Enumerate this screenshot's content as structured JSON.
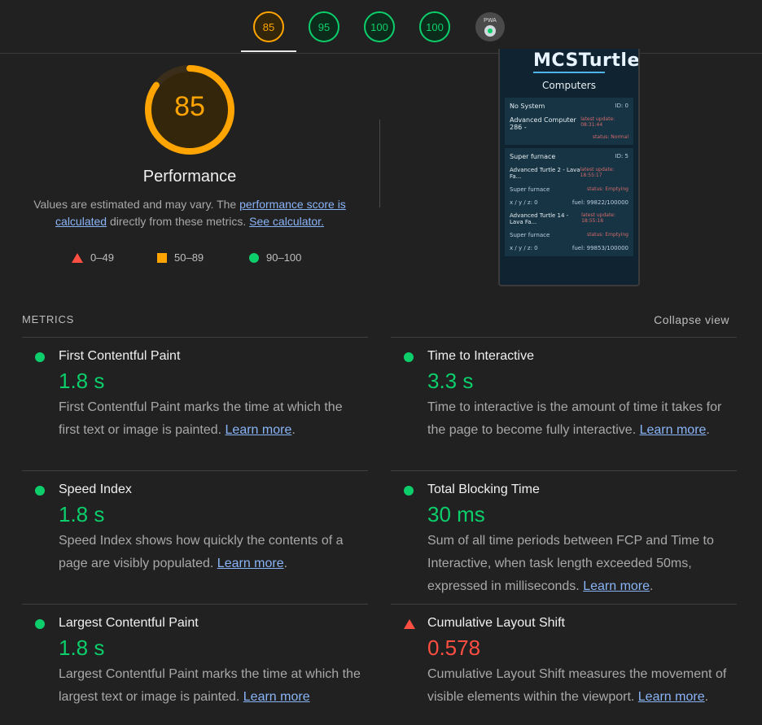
{
  "gauges": [
    {
      "label": "85",
      "status": "orange"
    },
    {
      "label": "95",
      "status": "green"
    },
    {
      "label": "100",
      "status": "green"
    },
    {
      "label": "100",
      "status": "green"
    },
    {
      "label": "PWA",
      "status": "pwa"
    }
  ],
  "performance": {
    "score": "85",
    "score_fraction": 0.85,
    "title": "Performance",
    "desc_prefix": "Values are estimated and may vary. The ",
    "score_link": "performance score is calculated",
    "desc_middle": " directly from these metrics. ",
    "calc_link": "See calculator."
  },
  "legend": {
    "fail": "0–49",
    "average": "50–89",
    "pass": "90–100"
  },
  "thumbnail": {
    "logo": "MCSTurtle",
    "subtitle": "Computers",
    "card1": {
      "name": "No System",
      "id": "ID: 0",
      "computer": "Advanced Computer 286 -",
      "update": "latest update: 08:31:44",
      "status": "status: Normal"
    },
    "card2": {
      "name": "Super furnace",
      "id": "ID: 5",
      "turtle1": "Advanced Turtle 2 - Lava Fa...",
      "turtle1_update": "latest update: 18:55:17",
      "turtle1_sub": "Super furnace",
      "turtle1_status": "status: Emptying",
      "turtle1_coords": "x / y / z: 0",
      "turtle1_fuel": "fuel: 99822/100000",
      "turtle2": "Advanced Turtle 14 - Lava Fa...",
      "turtle2_update": "latest update: 18:55:18",
      "turtle2_sub": "Super furnace",
      "turtle2_status": "status: Emptying",
      "turtle2_coords": "x / y / z: 0",
      "turtle2_fuel": "fuel: 99853/100000"
    }
  },
  "metrics": {
    "heading": "METRICS",
    "collapse": "Collapse view",
    "learn_more": "Learn more",
    "items": [
      {
        "title": "First Contentful Paint",
        "value": "1.8 s",
        "status": "pass",
        "desc": "First Contentful Paint marks the time at which the first text or image is painted. "
      },
      {
        "title": "Time to Interactive",
        "value": "3.3 s",
        "status": "pass",
        "desc": "Time to interactive is the amount of time it takes for the page to become fully interactive. "
      },
      {
        "title": "Speed Index",
        "value": "1.8 s",
        "status": "pass",
        "desc": "Speed Index shows how quickly the contents of a page are visibly populated. "
      },
      {
        "title": "Total Blocking Time",
        "value": "30 ms",
        "status": "pass",
        "desc": "Sum of all time periods between FCP and Time to Interactive, when task length exceeded 50ms, expressed in milliseconds. "
      },
      {
        "title": "Largest Contentful Paint",
        "value": "1.8 s",
        "status": "pass",
        "desc": "Largest Contentful Paint marks the time at which the largest text or image is painted. "
      },
      {
        "title": "Cumulative Layout Shift",
        "value": "0.578",
        "status": "fail",
        "desc": "Cumulative Layout Shift measures the movement of visible elements within the viewport. "
      }
    ]
  },
  "colors": {
    "pass": "#0cce6b",
    "average": "#ffa400",
    "fail": "#ff4e42",
    "link": "#8ab4f8"
  }
}
